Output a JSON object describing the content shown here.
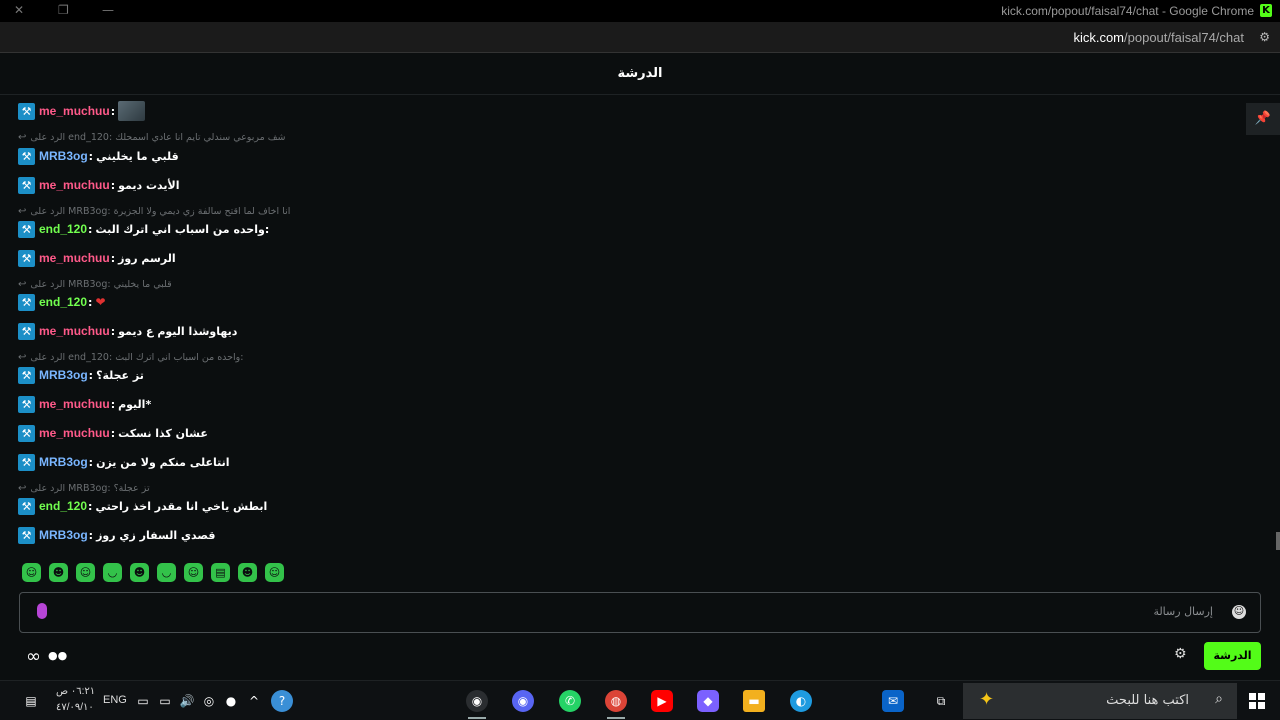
{
  "window": {
    "title": "kick.com/popout/faisal74/chat - Google Chrome",
    "url_host": "kick.com",
    "url_path": "/popout/faisal74/chat"
  },
  "chat": {
    "header": "الدرشة",
    "input_placeholder": "إرسال رسالة",
    "send_label": "الدرشة"
  },
  "messages": [
    {
      "user": "me_muchuu",
      "text": ""
    },
    {
      "reply": "الرد على end_120: شف مربوعي سندلي تايم انا عادي اسمحلك"
    },
    {
      "user": "MRB3og",
      "text": "قلبي ما يخليني"
    },
    {
      "user": "me_muchuu",
      "text": "الأيدت ديمو"
    },
    {
      "reply": "الرد على MRB3og: انا اخاف لما اقتح سالفة زي ديمي ولا الجزيرة"
    },
    {
      "user": "end_120",
      "text": "واحده من اسباب اني اترك البث:"
    },
    {
      "user": "me_muchuu",
      "text": "الرسم روز"
    },
    {
      "reply": "الرد على MRB3og: قلبي ما يخليني"
    },
    {
      "user": "end_120",
      "text": ""
    },
    {
      "user": "me_muchuu",
      "text": "ديهاوشذا اليوم ع ديمو"
    },
    {
      "reply": "الرد على end_120: واحده من اسباب اني اترك البث:"
    },
    {
      "user": "MRB3og",
      "text": "تز عجلة؟"
    },
    {
      "user": "me_muchuu",
      "text": "اليوم*"
    },
    {
      "user": "me_muchuu",
      "text": "عشان كذا نسكت"
    },
    {
      "user": "MRB3og",
      "text": "انتاعلى منكم ولا من يزن"
    },
    {
      "reply": "الرد على MRB3og: تز عجلة؟"
    },
    {
      "user": "end_120",
      "text": "ابطش ياخي انا مقدر اخذ راحتي"
    },
    {
      "user": "MRB3og",
      "text": "قصدي السفار زي روز"
    }
  ],
  "user_colors": {
    "me_muchuu": "#ff5a8a",
    "MRB3og": "#7ab6ff",
    "end_120": "#72ff4f"
  },
  "taskbar": {
    "lang": "ENG",
    "time": "٠٦:٢١ ص",
    "date": "٤٧/٠٩/١٠",
    "search_placeholder": "اكتب هنا للبحث"
  }
}
